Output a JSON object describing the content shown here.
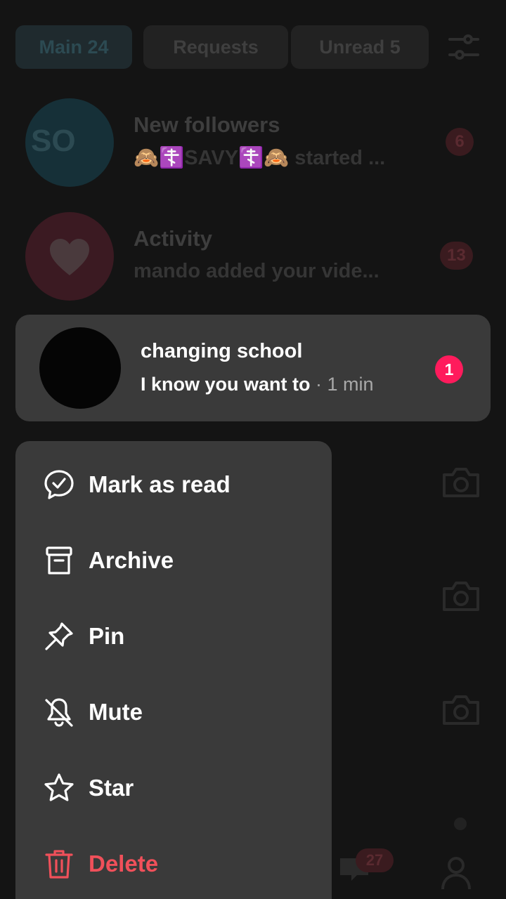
{
  "tabs": [
    {
      "label": "Main 24"
    },
    {
      "label": "Requests"
    },
    {
      "label": "Unread 5"
    }
  ],
  "background_rows": [
    {
      "title": "New followers",
      "subtitle": "🙈☦️SAVY☦️🙈 started ...",
      "count": "6",
      "avatar_text": "SO"
    },
    {
      "title": "Activity",
      "subtitle": "mando added your vide...",
      "count": "13"
    }
  ],
  "focused_chat": {
    "title": "changing school",
    "message": "I know you want to",
    "separator": " · ",
    "time": "1 min",
    "unread_count": "1"
  },
  "menu": {
    "items": [
      {
        "label": "Mark as read",
        "icon": "chat-check-icon"
      },
      {
        "label": "Archive",
        "icon": "archive-box-icon"
      },
      {
        "label": "Pin",
        "icon": "pin-icon"
      },
      {
        "label": "Mute",
        "icon": "bell-off-icon"
      },
      {
        "label": "Star",
        "icon": "star-icon"
      },
      {
        "label": "Delete",
        "icon": "trash-icon",
        "danger": true
      }
    ]
  },
  "nav": {
    "inbox_badge": "27"
  },
  "colors": {
    "background": "#141414",
    "card": "#3a3a3a",
    "badge": "#ff1b5c",
    "danger": "#f0505a"
  }
}
